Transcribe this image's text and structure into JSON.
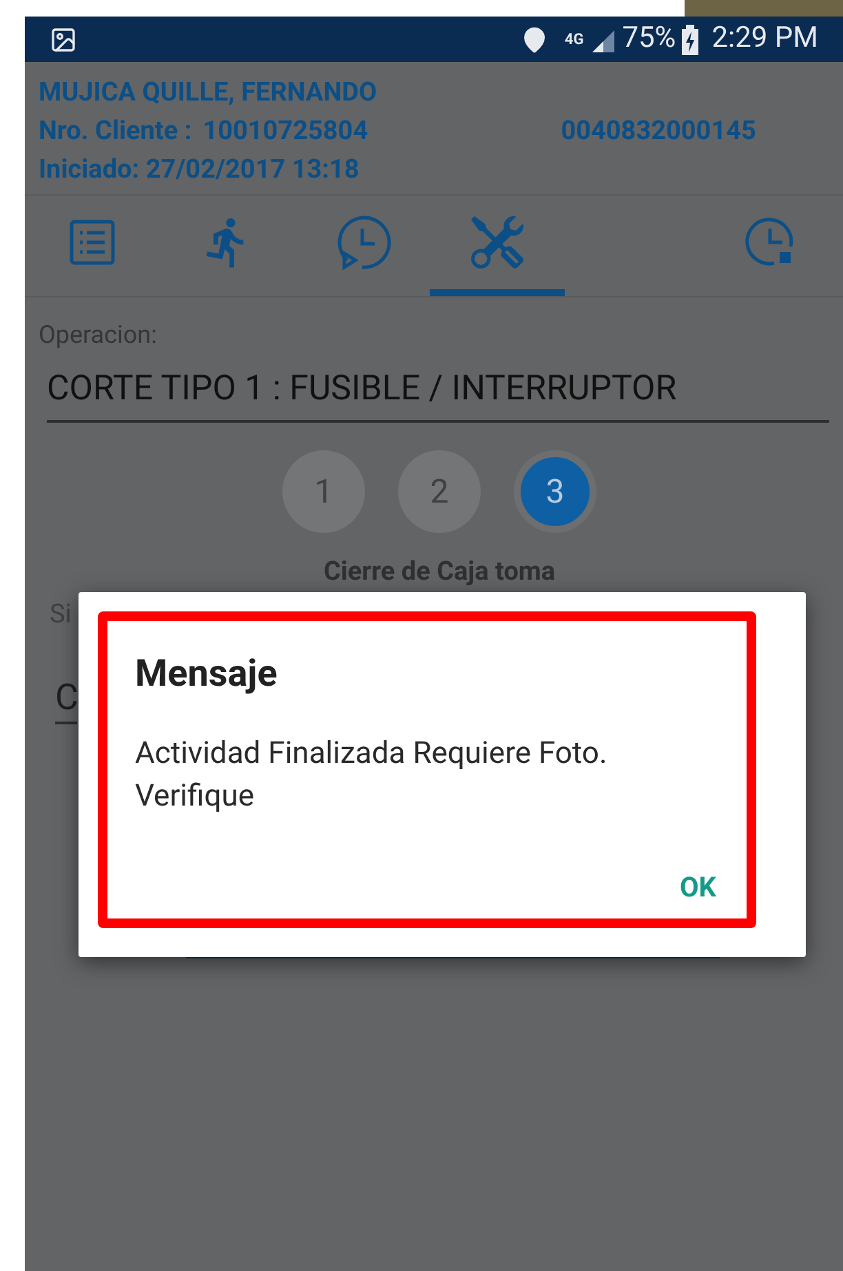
{
  "status_bar": {
    "network": "4G",
    "battery": "75%",
    "time": "2:29 PM"
  },
  "header": {
    "name": "MUJICA QUILLE, FERNANDO",
    "client_label": "Nro. Cliente :",
    "client_number": "10010725804",
    "code": "0040832000145",
    "started": "Iniciado: 27/02/2017 13:18"
  },
  "tabs": [
    {
      "kind": "list",
      "selected": false
    },
    {
      "kind": "run",
      "selected": false
    },
    {
      "kind": "clock-play",
      "selected": false
    },
    {
      "kind": "tools",
      "selected": true
    },
    {
      "kind": "clock-stop",
      "selected": false
    }
  ],
  "operation": {
    "label": "Operacion:",
    "value": "CORTE TIPO 1 : FUSIBLE / INTERRUPTOR"
  },
  "steps": [
    {
      "label": "1",
      "selected": false
    },
    {
      "label": "2",
      "selected": false
    },
    {
      "label": "3",
      "selected": true
    }
  ],
  "step_title": "Cierre de Caja toma",
  "partial_label": "Si",
  "partial_field": "C",
  "dialog": {
    "title": "Mensaje",
    "message": "Actividad Finalizada Requiere Foto. Verifique",
    "button": "OK"
  }
}
